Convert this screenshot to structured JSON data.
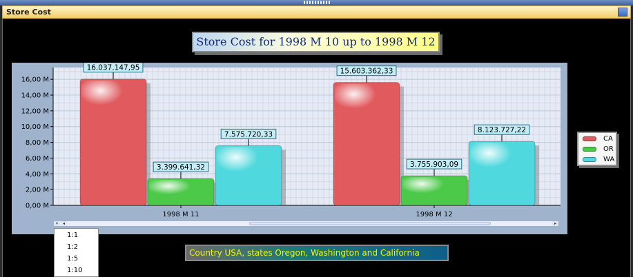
{
  "window": {
    "title": "Store Cost"
  },
  "chart_title": "Store Cost for 1998 M 10 up to 1998 M 12",
  "subtitle": "Country USA, states Oregon, Washington and California",
  "zoom_menu": {
    "items": [
      "1:1",
      "1:2",
      "1:5",
      "1:10"
    ]
  },
  "colors": {
    "CA": "#e05a5e",
    "OR": "#4dc94a",
    "WA": "#4fd8dd",
    "title_bar": "#f3cd6b",
    "plot_panel": "#9fb3cc"
  },
  "chart_data": {
    "type": "bar",
    "title": "Store Cost for 1998 M 10 up to 1998 M 12",
    "categories": [
      "1998 M 11",
      "1998 M 12"
    ],
    "series": [
      {
        "name": "CA",
        "values": [
          16037147.95,
          15603362.33
        ],
        "labels": [
          "16.037.147,95",
          "15.603.362,33"
        ]
      },
      {
        "name": "OR",
        "values": [
          3399641.32,
          3755903.09
        ],
        "labels": [
          "3.399.641,32",
          "3.755.903,09"
        ]
      },
      {
        "name": "WA",
        "values": [
          7575720.33,
          8123727.22
        ],
        "labels": [
          "7.575.720,33",
          "8.123.727,22"
        ]
      }
    ],
    "yticks": [
      "0,00 M",
      "2,00 M",
      "4,00 M",
      "6,00 M",
      "8,00 M",
      "10,00 M",
      "12,00 M",
      "14,00 M",
      "16,00 M"
    ],
    "ylim": [
      0,
      17500000
    ],
    "grid": true,
    "legend_position": "right"
  }
}
